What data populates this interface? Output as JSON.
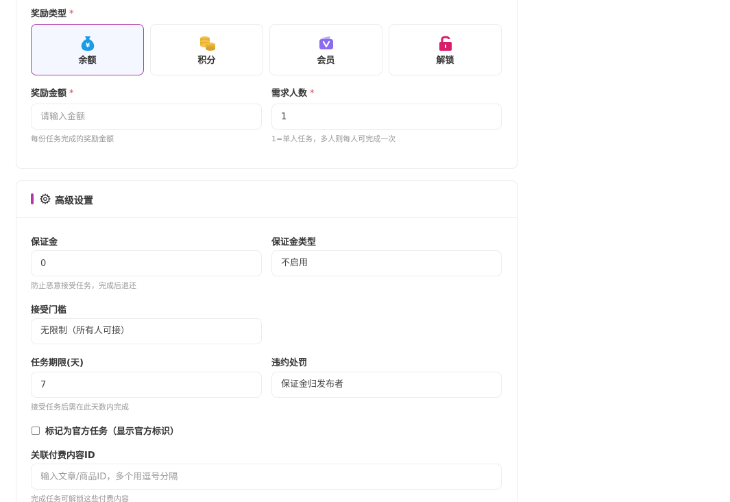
{
  "reward_type": {
    "label": "奖励类型",
    "required_mark": "*",
    "options": [
      {
        "label": "余额",
        "icon": "money-bag-icon",
        "selected": true
      },
      {
        "label": "积分",
        "icon": "coins-icon",
        "selected": false
      },
      {
        "label": "会员",
        "icon": "vip-badge-icon",
        "selected": false
      },
      {
        "label": "解锁",
        "icon": "unlock-icon",
        "selected": false
      }
    ]
  },
  "reward_amount": {
    "label": "奖励金额",
    "required_mark": "*",
    "value": "",
    "placeholder": "请输入金额",
    "hint": "每份任务完成的奖励金额"
  },
  "required_people": {
    "label": "需求人数",
    "required_mark": "*",
    "value": "1",
    "hint": "1=单人任务，多人则每人可完成一次"
  },
  "advanced": {
    "title": "高级设置",
    "deposit": {
      "label": "保证金",
      "value": "0",
      "hint": "防止恶意接受任务，完成后退还"
    },
    "deposit_type": {
      "label": "保证金类型",
      "value": "不启用"
    },
    "threshold": {
      "label": "接受门槛",
      "value": "无限制（所有人可接）"
    },
    "deadline": {
      "label": "任务期限(天)",
      "value": "7",
      "hint": "接受任务后需在此天数内完成"
    },
    "penalty": {
      "label": "违约处罚",
      "value": "保证金归发布者"
    },
    "official": {
      "label": "标记为官方任务（显示官方标识）",
      "checked": false
    },
    "paid_content": {
      "label": "关联付费内容ID",
      "value": "",
      "placeholder": "输入文章/商品ID，多个用逗号分隔",
      "hint": "完成任务可解锁这些付费内容"
    }
  },
  "colors": {
    "accent": "#b23aa8",
    "required": "#e0455a",
    "money_icon": "#1a9be6",
    "coins_icon": "#e7b032",
    "vip_icon": "#8b6cf0",
    "unlock_icon": "#d81e6a"
  }
}
